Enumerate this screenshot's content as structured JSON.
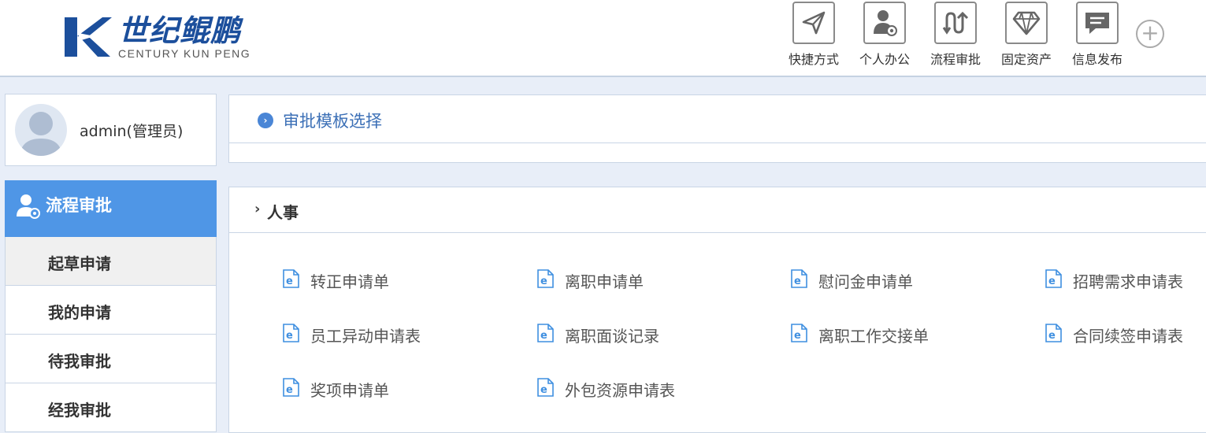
{
  "brand": {
    "name_cn": "世纪鲲鹏",
    "name_en": "CENTURY KUN PENG",
    "color": "#1c4f9c"
  },
  "topnav": [
    {
      "label": "快捷方式",
      "icon": "send-icon"
    },
    {
      "label": "个人办公",
      "icon": "user-office-icon"
    },
    {
      "label": "流程审批",
      "icon": "workflow-icon"
    },
    {
      "label": "固定资产",
      "icon": "diamond-icon"
    },
    {
      "label": "信息发布",
      "icon": "message-icon"
    }
  ],
  "user": {
    "name": "admin(管理员)"
  },
  "sidebar": {
    "section_title": "流程审批",
    "accent": "#4f96e6",
    "items": [
      {
        "label": "起草申请",
        "active": true
      },
      {
        "label": "我的申请",
        "active": false
      },
      {
        "label": "待我审批",
        "active": false
      },
      {
        "label": "经我审批",
        "active": false
      }
    ]
  },
  "main": {
    "template_panel_title": "审批模板选择",
    "category": "人事",
    "forms": [
      "转正申请单",
      "离职申请单",
      "慰问金申请单",
      "招聘需求申请表",
      "员工异动申请表",
      "离职面谈记录",
      "离职工作交接单",
      "合同续签申请表",
      "奖项申请单",
      "外包资源申请表"
    ]
  }
}
